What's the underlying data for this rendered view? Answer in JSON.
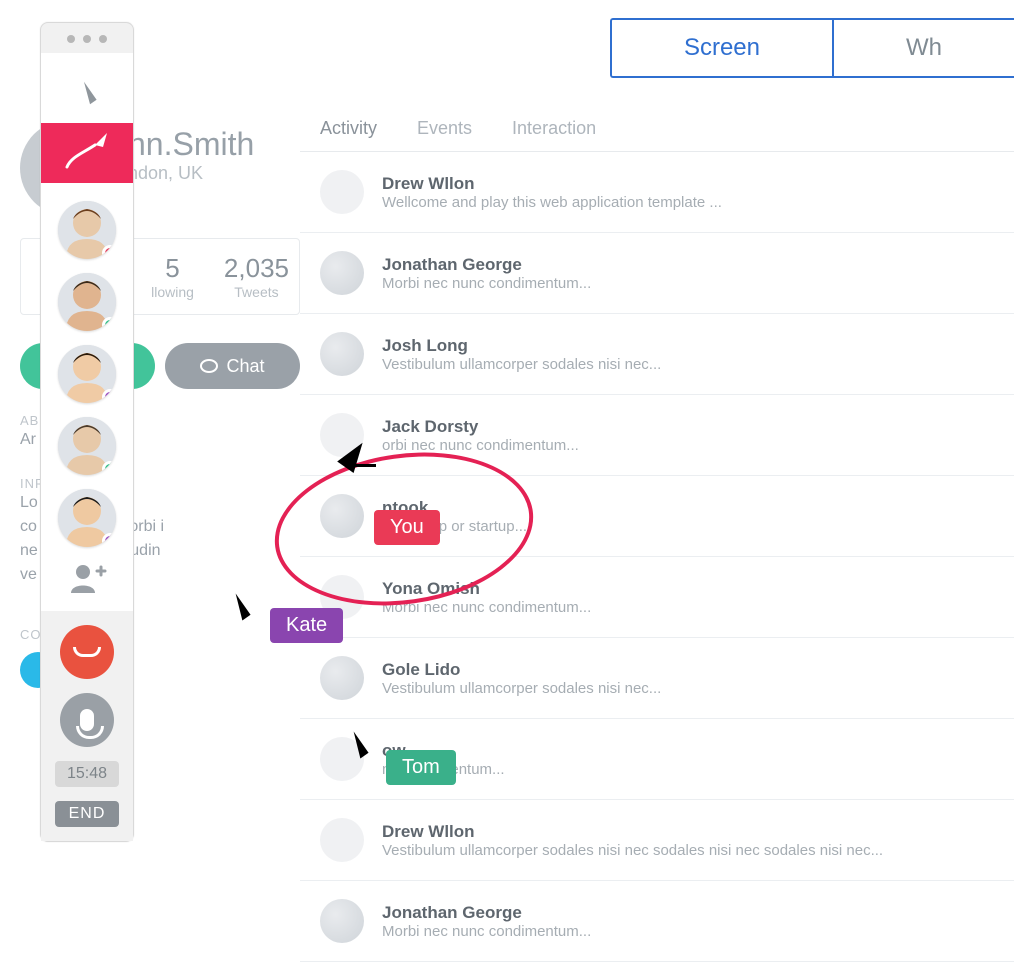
{
  "topTabs": {
    "active": "Screen",
    "other": "Wh"
  },
  "profile": {
    "name": "hn.Smith",
    "location": "ndon, UK",
    "stats": [
      {
        "n": "5",
        "l": "llowing"
      },
      {
        "n": "2,035",
        "l": "Tweets"
      }
    ],
    "chat_label": "Chat",
    "about_h": "AB",
    "about_t": "Ar",
    "info_h": "INF",
    "info_t": "Lo            or sit amet,\nco            iscing elit. Morbi i\nne            quam sollicitudin\nve            ac feugiat.",
    "contact_h": "CO"
  },
  "activity": {
    "tabs": {
      "activity": "Activity",
      "events": "Events",
      "interaction": "Interaction"
    },
    "items": [
      {
        "name": "Drew Wllon",
        "text": "Wellcome and play this web application template ...",
        "light": true
      },
      {
        "name": "Jonathan George",
        "text": "Morbi nec nunc condimentum...",
        "light": false
      },
      {
        "name": "Josh Long",
        "text": "Vestibulum ullamcorper sodales nisi nec...",
        "light": false
      },
      {
        "name": "Jack Dorsty",
        "text": "orbi nec nunc condimentum...",
        "light": true
      },
      {
        "name": "ntook",
        "text": "t web app   or startup...",
        "light": false
      },
      {
        "name": "Yona Omish",
        "text": "Morbi nec nunc condimentum...",
        "light": true
      },
      {
        "name": "Gole Lido",
        "text": "Vestibulum ullamcorper sodales nisi nec...",
        "light": false
      },
      {
        "name": "ow",
        "text": "nc condimentum...",
        "light": true
      },
      {
        "name": "Drew Wllon",
        "text": "Vestibulum ullamcorper sodales nisi nec sodales nisi nec sodales nisi nec...",
        "light": true
      },
      {
        "name": "Jonathan George",
        "text": "Morbi nec nunc condimentum...",
        "light": false
      }
    ]
  },
  "collab": {
    "participants_status": [
      "red",
      "green",
      "purple",
      "green",
      "purple"
    ],
    "time": "15:48",
    "end": "END"
  },
  "cursors": {
    "you": "You",
    "kate": "Kate",
    "tom": "Tom"
  }
}
